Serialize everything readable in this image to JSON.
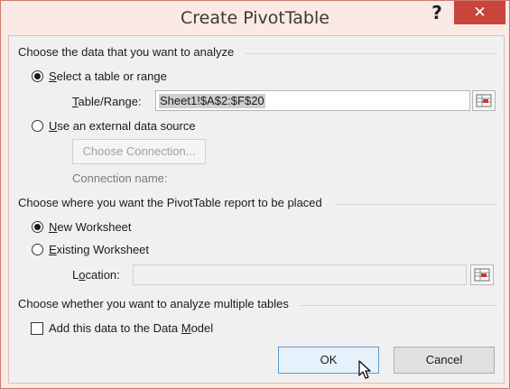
{
  "window": {
    "title": "Create PivotTable",
    "help_glyph": "?",
    "close_glyph": "✕"
  },
  "data_section": {
    "heading": "Choose the data that you want to analyze",
    "option_range": {
      "selected": true,
      "mnemonic": "S",
      "rest": "elect a table or range"
    },
    "table_range": {
      "mnemonic": "T",
      "rest": "able/Range:",
      "value": "Sheet1!$A$2:$F$20"
    },
    "option_external": {
      "selected": false,
      "mnemonic": "U",
      "rest": "se an external data source"
    },
    "choose_connection_label": "Choose Connection...",
    "connection_name_label": "Connection name:"
  },
  "placement_section": {
    "heading": "Choose where you want the PivotTable report to be placed",
    "option_new": {
      "selected": true,
      "mnemonic": "N",
      "rest": "ew Worksheet"
    },
    "option_existing": {
      "selected": false,
      "mnemonic": "E",
      "rest": "xisting Worksheet"
    },
    "location": {
      "before": "L",
      "mnemonic": "o",
      "rest": "cation:",
      "value": ""
    }
  },
  "multiple_section": {
    "heading": "Choose whether you want to analyze multiple tables",
    "data_model": {
      "checked": false,
      "before": "Add this data to the Data ",
      "mnemonic": "M",
      "rest": "odel"
    }
  },
  "buttons": {
    "ok_label": "OK",
    "cancel_label": "Cancel"
  },
  "colors": {
    "window_frame": "#fbe9e5",
    "close_button": "#c7453c",
    "default_button_border": "#5a9bd5"
  }
}
